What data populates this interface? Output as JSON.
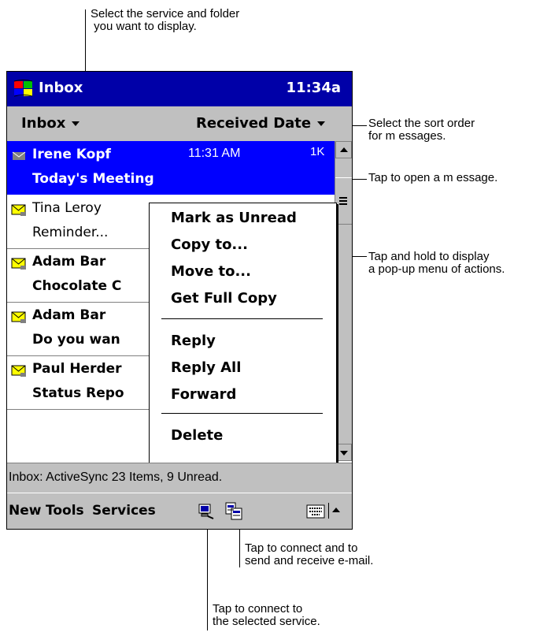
{
  "callouts": {
    "top": "Select the service and folder\n you want to display.",
    "sort": "Select the sort order\nfor m essages.",
    "open": "Tap to open a m essage.",
    "popup": "Tap and hold to display\na pop-up menu of actions.",
    "send_receive": "Tap to connect and to\nsend and receive e-mail.",
    "connect": "Tap to connect to\nthe selected service."
  },
  "titlebar": {
    "title": "Inbox",
    "time": "11:34a",
    "icon": "start-flag-icon"
  },
  "navbar": {
    "folder": "Inbox",
    "sort": "Received Date"
  },
  "messages": [
    {
      "from": "Irene Kopf",
      "subject": "Today's Meeting",
      "time": "11:31 AM",
      "size": "1K",
      "selected": true,
      "unread": true
    },
    {
      "from": "Tina Leroy",
      "subject": "Reminder...",
      "unread": false
    },
    {
      "from": "Adam Bar",
      "subject": "Chocolate C",
      "unread": true
    },
    {
      "from": "Adam Bar",
      "subject": "Do you wan",
      "unread": true
    },
    {
      "from": "Paul Herder",
      "subject": "Status Repo",
      "unread": true
    }
  ],
  "popup_menu": [
    "Mark as Unread",
    "Copy to...",
    "Move to...",
    "Get Full Copy",
    "Reply",
    "Reply All",
    "Forward",
    "Delete"
  ],
  "status": {
    "text": "Inbox: ActiveSync  23 Items, 9 Unread."
  },
  "commandbar": {
    "menus": [
      "New",
      "Tools",
      "Services"
    ],
    "connect_icon": "connect-icon",
    "send_receive_icon": "send-receive-icon",
    "keyboard_icon": "keyboard-icon"
  },
  "colors": {
    "titlebar": "#0000a8",
    "selection": "#0000ff",
    "chrome": "#c0c0c0"
  }
}
